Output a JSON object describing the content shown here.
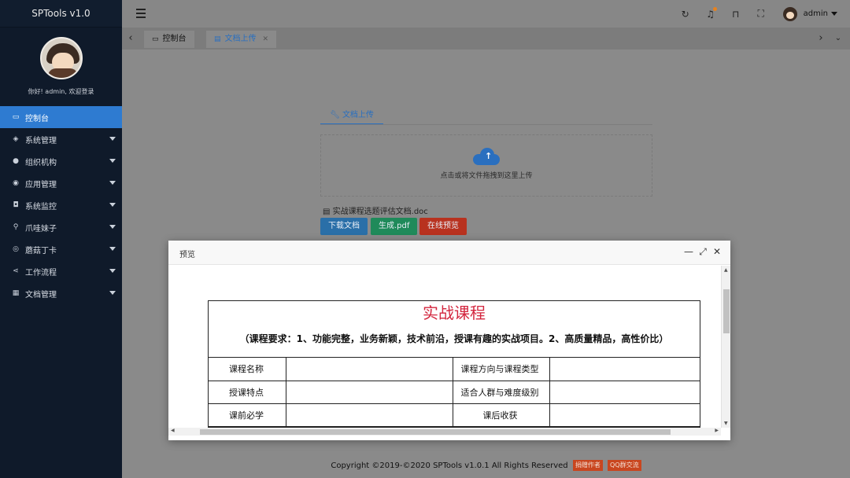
{
  "app": {
    "title": "SPTools v1.0"
  },
  "profile": {
    "welcome": "你好! admin, 欢迎登录"
  },
  "sidebar": {
    "items": [
      {
        "label": "控制台",
        "icon": "monitor-icon",
        "active": true
      },
      {
        "label": "系统管理",
        "icon": "layers-icon"
      },
      {
        "label": "组织机构",
        "icon": "users-icon"
      },
      {
        "label": "应用管理",
        "icon": "compass-icon"
      },
      {
        "label": "系统监控",
        "icon": "camera-icon"
      },
      {
        "label": "爪哇妹子",
        "icon": "key-icon"
      },
      {
        "label": "蘑菇丁卡",
        "icon": "map-pin-icon"
      },
      {
        "label": "工作流程",
        "icon": "share-icon"
      },
      {
        "label": "文档管理",
        "icon": "calendar-icon"
      }
    ]
  },
  "header": {
    "user": "admin",
    "notification_dot_color": "#e8821e"
  },
  "tabs": [
    {
      "label": "控制台",
      "icon": "monitor-icon"
    },
    {
      "label": "文档上传",
      "icon": "file-icon",
      "closable": true,
      "active": true
    }
  ],
  "upload": {
    "tab_label": "文档上传",
    "dropzone_text": "点击或将文件拖拽到这里上传",
    "file_name": "实战课程选题评估文档.doc",
    "buttons": {
      "download": "下载文档",
      "pdf": "生成.pdf",
      "preview": "在线预览"
    }
  },
  "footer": {
    "copyright": "Copyright ©2019-©2020 SPTools v1.0.1 All Rights Reserved",
    "badge_donate": "捐赠作者",
    "badge_qq": "QQ群交流"
  },
  "modal": {
    "title": "预览",
    "doc": {
      "title": "实战课程",
      "requirement": "（课程要求：1、功能完整，业务新颖，技术前沿，授课有趣的实战项目。2、高质量精品，高性价比）",
      "rows": [
        [
          "课程名称",
          "",
          "课程方向与课程类型",
          ""
        ],
        [
          "授课特点",
          "",
          "适合人群与难度级别",
          ""
        ],
        [
          "课前必学",
          "",
          "课后收获",
          ""
        ]
      ]
    }
  },
  "colors": {
    "accent": "#2e7bd1",
    "sidebar_bg": "#0f1a2a",
    "doc_title": "#d3263e"
  }
}
